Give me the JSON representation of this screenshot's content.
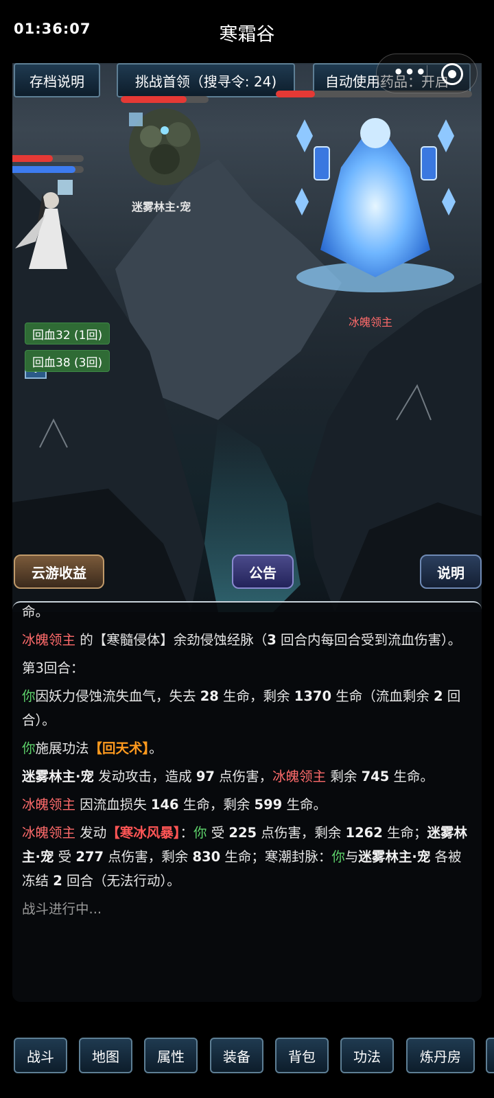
{
  "status": {
    "time": "01:36:07"
  },
  "title": "寒霜谷",
  "top_buttons": {
    "save_info": "存档说明",
    "challenge": "挑战首领（搜寻令: 24)",
    "auto_potion": "自动使用药品：开启"
  },
  "units": {
    "pet_name": "迷雾林主·宠",
    "boss_name": "冰魄领主"
  },
  "buffs": [
    "回血32 (1回)",
    "回血38 (3回)"
  ],
  "scene_buttons": {
    "cloud_income": "云游收益",
    "notice": "公告",
    "explain": "说明"
  },
  "log": {
    "l0": "命。",
    "l1_a": "冰魄领主",
    "l1_b": " 的【寒髓侵体】余劲侵蚀经脉（",
    "l1_c": "3",
    "l1_d": " 回合内每回合受到流血伤害）。",
    "l2": "第3回合：",
    "l3_a": "你",
    "l3_b": "因妖力侵蚀流失血气，失去 ",
    "l3_c": "28",
    "l3_d": " 生命，剩余 ",
    "l3_e": "1370",
    "l3_f": " 生命（流血剩余 ",
    "l3_g": "2",
    "l3_h": " 回合）。",
    "l4_a": "你",
    "l4_b": "施展功法",
    "l4_c": "【回天术】",
    "l4_d": "。",
    "l5_a": "迷雾林主·宠",
    "l5_b": " 发动攻击，造成 ",
    "l5_c": "97",
    "l5_d": " 点伤害，",
    "l5_e": "冰魄领主",
    "l5_f": " 剩余 ",
    "l5_g": "745",
    "l5_h": " 生命。",
    "l6_a": "冰魄领主",
    "l6_b": " 因流血损失 ",
    "l6_c": "146",
    "l6_d": " 生命，剩余 ",
    "l6_e": "599",
    "l6_f": " 生命。",
    "l7_a": "冰魄领主",
    "l7_b": " 发动",
    "l7_c": "【寒冰风暴】",
    "l7_d": "：",
    "l7_e": "你",
    "l7_f": " 受 ",
    "l7_g": "225",
    "l7_h": " 点伤害，剩余 ",
    "l7_i": "1262",
    "l7_j": " 生命；",
    "l7_k": "迷雾林主·宠",
    "l7_l": " 受 ",
    "l7_m": "277",
    "l7_n": " 点伤害，剩余 ",
    "l7_o": "830",
    "l7_p": " 生命；寒潮封脉：",
    "l7_q": "你",
    "l7_r": "与",
    "l7_s": "迷雾林主·宠",
    "l7_t": " 各被冻结 ",
    "l7_u": "2",
    "l7_v": " 回合（无法行动）。",
    "l8": "战斗进行中..."
  },
  "nav": [
    "战斗",
    "地图",
    "属性",
    "装备",
    "背包",
    "功法",
    "炼丹房"
  ],
  "levels": {
    "player_hp_fraction": 0.62,
    "player_mp_fraction": 0.9,
    "pet_hp_fraction": 0.75,
    "boss_hp_fraction": 0.2
  },
  "colors": {
    "hp": "#e53935",
    "mp": "#3d7bf0",
    "enemy_name": "#ff6b6b",
    "you": "#5ed36b",
    "skill": "#ff9a1e"
  }
}
